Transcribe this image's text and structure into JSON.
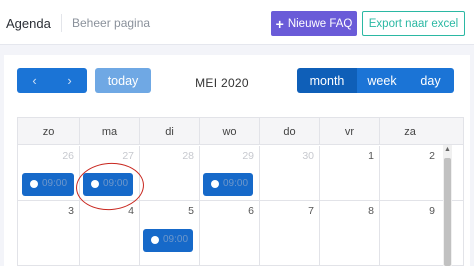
{
  "header": {
    "tabs": [
      {
        "label": "Agenda"
      },
      {
        "label": "Beheer pagina"
      }
    ],
    "new_faq_label": "Nieuwe FAQ",
    "export_label": "Export naar excel",
    "colors": {
      "new_faq": "#6a5bd8",
      "export": "#2bb8a3"
    }
  },
  "calendar": {
    "prev_icon": "chevron-left-icon",
    "next_icon": "chevron-right-icon",
    "today_label": "today",
    "title": "MEI 2020",
    "views": [
      {
        "label": "month",
        "active": true
      },
      {
        "label": "week",
        "active": false
      },
      {
        "label": "day",
        "active": false
      }
    ],
    "weekdays": [
      "zo",
      "ma",
      "di",
      "wo",
      "do",
      "vr",
      "za"
    ],
    "weeks": [
      [
        {
          "day": "26",
          "other": true,
          "events": [
            "09:00"
          ]
        },
        {
          "day": "27",
          "other": true,
          "events": [
            "09:00"
          ]
        },
        {
          "day": "28",
          "other": true,
          "events": []
        },
        {
          "day": "29",
          "other": true,
          "events": [
            "09:00"
          ]
        },
        {
          "day": "30",
          "other": true,
          "events": []
        },
        {
          "day": "1",
          "other": false,
          "events": []
        },
        {
          "day": "2",
          "other": false,
          "events": []
        }
      ],
      [
        {
          "day": "3",
          "other": false,
          "events": []
        },
        {
          "day": "4",
          "other": false,
          "events": []
        },
        {
          "day": "5",
          "other": false,
          "events": [
            "09:00"
          ]
        },
        {
          "day": "6",
          "other": false,
          "events": []
        },
        {
          "day": "7",
          "other": false,
          "events": []
        },
        {
          "day": "8",
          "other": false,
          "events": []
        },
        {
          "day": "9",
          "other": false,
          "events": []
        }
      ]
    ],
    "event_color": "#1669c9"
  }
}
